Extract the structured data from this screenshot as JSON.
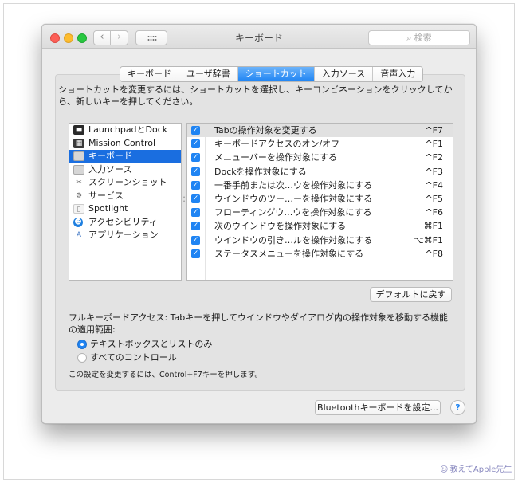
{
  "window": {
    "title": "キーボード",
    "search_placeholder": "検索",
    "nav_back": "‹",
    "nav_forward": "›"
  },
  "tabs": [
    {
      "label": "キーボード",
      "active": false
    },
    {
      "label": "ユーザ辞書",
      "active": false
    },
    {
      "label": "ショートカット",
      "active": true
    },
    {
      "label": "入力ソース",
      "active": false
    },
    {
      "label": "音声入力",
      "active": false
    }
  ],
  "instructions": "ショートカットを変更するには、ショートカットを選択し、キーコンビネーションをクリックしてから、新しいキーを押してください。",
  "categories": [
    {
      "label": "LaunchpadとDock",
      "icon": "launchpad-icon",
      "glyph": "▬",
      "selected": false
    },
    {
      "label": "Mission Control",
      "icon": "mission-control-icon",
      "glyph": "▦",
      "selected": false
    },
    {
      "label": "キーボード",
      "icon": "keyboard-icon",
      "glyph": "",
      "selected": true
    },
    {
      "label": "入力ソース",
      "icon": "input-source-icon",
      "glyph": "",
      "selected": false
    },
    {
      "label": "スクリーンショット",
      "icon": "screenshot-icon",
      "glyph": "✂",
      "selected": false
    },
    {
      "label": "サービス",
      "icon": "services-gear-icon",
      "glyph": "⚙",
      "selected": false
    },
    {
      "label": "Spotlight",
      "icon": "spotlight-icon",
      "glyph": "▯",
      "selected": false
    },
    {
      "label": "アクセシビリティ",
      "icon": "accessibility-icon",
      "glyph": "☻",
      "selected": false
    },
    {
      "label": "アプリケーション",
      "icon": "app-shortcuts-icon",
      "glyph": "A",
      "selected": false
    }
  ],
  "shortcuts": [
    {
      "label": "Tabの操作対象を変更する",
      "key": "^F7",
      "checked": true,
      "selected": true
    },
    {
      "label": "キーボードアクセスのオン/オフ",
      "key": "^F1",
      "checked": true,
      "selected": false
    },
    {
      "label": "メニューバーを操作対象にする",
      "key": "^F2",
      "checked": true,
      "selected": false
    },
    {
      "label": "Dockを操作対象にする",
      "key": "^F3",
      "checked": true,
      "selected": false
    },
    {
      "label": "一番手前または次…ウを操作対象にする",
      "key": "^F4",
      "checked": true,
      "selected": false
    },
    {
      "label": "ウインドウのツー…ーを操作対象にする",
      "key": "^F5",
      "checked": true,
      "selected": false
    },
    {
      "label": "フローティングウ…ウを操作対象にする",
      "key": "^F6",
      "checked": true,
      "selected": false
    },
    {
      "label": "次のウインドウを操作対象にする",
      "key": "⌘F1",
      "checked": true,
      "selected": false
    },
    {
      "label": "ウインドウの引き…ルを操作対象にする",
      "key": "⌥⌘F1",
      "checked": true,
      "selected": false
    },
    {
      "label": "ステータスメニューを操作対象にする",
      "key": "^F8",
      "checked": true,
      "selected": false
    }
  ],
  "restore_defaults_label": "デフォルトに戻す",
  "full_keyboard_access": {
    "description": "フルキーボードアクセス: Tabキーを押してウインドウやダイアログ内の操作対象を移動する機能の適用範囲:",
    "options": [
      {
        "label": "テキストボックスとリストのみ",
        "selected": true
      },
      {
        "label": "すべてのコントロール",
        "selected": false
      }
    ],
    "note": "この設定を変更するには、Control+F7キーを押します。"
  },
  "bluetooth_button_label": "Bluetoothキーボードを設定...",
  "help_label": "?",
  "watermark": "教えてApple先生",
  "colors": {
    "accent": "#1f84f3",
    "selection": "#1a6ee0",
    "window_bg": "#ececec"
  }
}
